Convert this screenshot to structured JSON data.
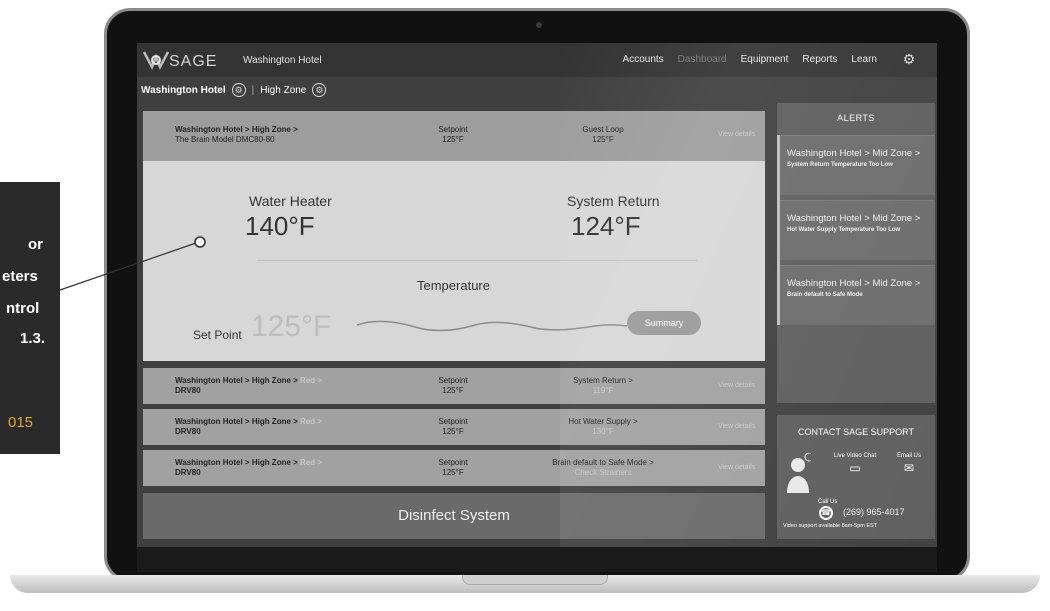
{
  "callout": {
    "line1": "or",
    "line2": "eters",
    "line3": "ntrol",
    "line4": "1.3.",
    "year": "015"
  },
  "app": {
    "logo": "SAGE",
    "hotel": "Washington Hotel",
    "nav": [
      "Accounts",
      "Dashboard",
      "Equipment",
      "Reports",
      "Learn"
    ]
  },
  "breadcrumb": {
    "hotel": "Washington Hotel",
    "zone": "High Zone"
  },
  "main": {
    "header": {
      "path": "Washington Hotel  > High Zone >",
      "model": "The Brain Model DMC80-80",
      "setpoint_label": "Setpoint",
      "setpoint_value": "125°F",
      "loop_label": "Guest Loop",
      "loop_value": "125°F",
      "view_details": "View details"
    },
    "water_heater_label": "Water Heater",
    "water_heater_value": "140°F",
    "system_return_label": "System Return",
    "system_return_value": "124°F",
    "temperature_label": "Temperature",
    "set_point_label": "Set Point",
    "set_point_value": "125°F",
    "summary_button": "Summary"
  },
  "rows": [
    {
      "path": "Washington Hotel > High Zone > ",
      "red": "Red >",
      "model": "DRV80",
      "setpoint_label": "Setpoint",
      "setpoint_value": "125°F",
      "metric_label": "System Return >",
      "metric_value": "119°F",
      "view_details": "View details"
    },
    {
      "path": "Washington Hotel > High Zone > ",
      "red": "Red >",
      "model": "DRV80",
      "setpoint_label": "Setpoint",
      "setpoint_value": "125°F",
      "metric_label": "Hot Water Supply >",
      "metric_value": "130°F",
      "view_details": "View details"
    },
    {
      "path": "Washington Hotel > High Zone > ",
      "red": "Red >",
      "model": "DRV80",
      "setpoint_label": "Setpoint",
      "setpoint_value": "125°F",
      "metric_label": "Brain default to Safe Mode >",
      "metric_value": "Check Strainers",
      "view_details": "View details"
    }
  ],
  "disinfect_button": "Disinfect System",
  "alerts": {
    "title": "ALERTS",
    "items": [
      {
        "title": "Washington Hotel > Mid Zone >",
        "detail": "System Return Temperature Too Low"
      },
      {
        "title": "Washington Hotel > Mid Zone >",
        "detail": "Hot Water Supply Temperature Too Low"
      },
      {
        "title": "Washington Hotel > Mid Zone >",
        "detail": "Brain default to Safe Mode"
      }
    ]
  },
  "contact": {
    "title": "CONTACT SAGE SUPPORT",
    "video_chat": "Live Video Chat",
    "email": "Email Us",
    "call_us": "Call Us",
    "phone": "(269) 965-4017",
    "hours": "Video support available 8am-5pm EST"
  },
  "colors": {
    "screen_bg": "#3f3f3f",
    "card_head": "#9d9d9d",
    "card_body": "#d7d7d7",
    "callout_bg": "#2a2a2a",
    "callout_accent": "#e0a82e"
  }
}
